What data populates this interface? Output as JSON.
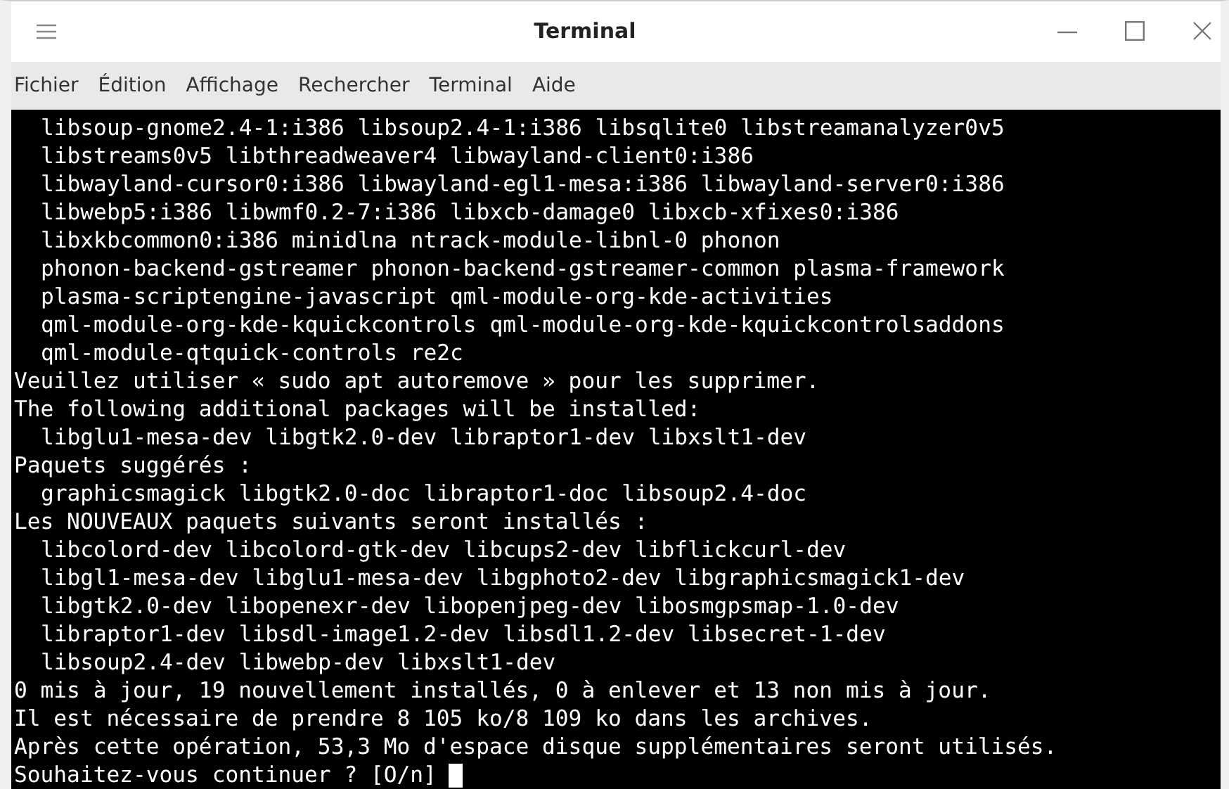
{
  "window": {
    "title": "Terminal"
  },
  "menu": [
    "Fichier",
    "Édition",
    "Affichage",
    "Rechercher",
    "Terminal",
    "Aide"
  ],
  "lines": [
    {
      "kind": "package",
      "text": "libsoup-gnome2.4-1:i386 libsoup2.4-1:i386 libsqlite0 libstreamanalyzer0v5"
    },
    {
      "kind": "package",
      "text": "libstreams0v5 libthreadweaver4 libwayland-client0:i386"
    },
    {
      "kind": "package",
      "text": "libwayland-cursor0:i386 libwayland-egl1-mesa:i386 libwayland-server0:i386"
    },
    {
      "kind": "package",
      "text": "libwebp5:i386 libwmf0.2-7:i386 libxcb-damage0 libxcb-xfixes0:i386"
    },
    {
      "kind": "package",
      "text": "libxkbcommon0:i386 minidlna ntrack-module-libnl-0 phonon"
    },
    {
      "kind": "package",
      "text": "phonon-backend-gstreamer phonon-backend-gstreamer-common plasma-framework"
    },
    {
      "kind": "package",
      "text": "plasma-scriptengine-javascript qml-module-org-kde-activities"
    },
    {
      "kind": "package",
      "text": "qml-module-org-kde-kquickcontrols qml-module-org-kde-kquickcontrolsaddons"
    },
    {
      "kind": "package",
      "text": "qml-module-qtquick-controls re2c"
    },
    {
      "kind": "message",
      "text": "Veuillez utiliser « sudo apt autoremove » pour les supprimer."
    },
    {
      "kind": "message",
      "text": "The following additional packages will be installed:"
    },
    {
      "kind": "package",
      "text": "libglu1-mesa-dev libgtk2.0-dev libraptor1-dev libxslt1-dev"
    },
    {
      "kind": "message",
      "text": "Paquets suggérés :"
    },
    {
      "kind": "package",
      "text": "graphicsmagick libgtk2.0-doc libraptor1-doc libsoup2.4-doc"
    },
    {
      "kind": "message",
      "text": "Les NOUVEAUX paquets suivants seront installés :"
    },
    {
      "kind": "package",
      "text": "libcolord-dev libcolord-gtk-dev libcups2-dev libflickcurl-dev"
    },
    {
      "kind": "package",
      "text": "libgl1-mesa-dev libglu1-mesa-dev libgphoto2-dev libgraphicsmagick1-dev"
    },
    {
      "kind": "package",
      "text": "libgtk2.0-dev libopenexr-dev libopenjpeg-dev libosmgpsmap-1.0-dev"
    },
    {
      "kind": "package",
      "text": "libraptor1-dev libsdl-image1.2-dev libsdl1.2-dev libsecret-1-dev"
    },
    {
      "kind": "package",
      "text": "libsoup2.4-dev libwebp-dev libxslt1-dev"
    },
    {
      "kind": "message",
      "text": "0 mis à jour, 19 nouvellement installés, 0 à enlever et 13 non mis à jour."
    },
    {
      "kind": "message",
      "text": "Il est nécessaire de prendre 8 105 ko/8 109 ko dans les archives."
    },
    {
      "kind": "message",
      "text": "Après cette opération, 53,3 Mo d'espace disque supplémentaires seront utilisés."
    },
    {
      "kind": "prompt",
      "text": "Souhaitez-vous continuer ? [O/n]"
    }
  ]
}
